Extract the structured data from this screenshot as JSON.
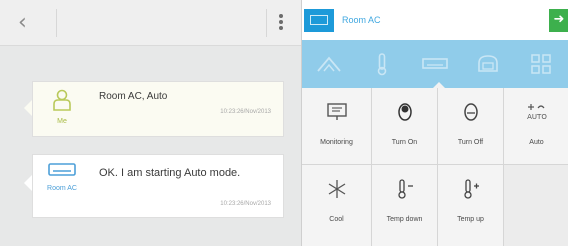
{
  "chat": {
    "messages": [
      {
        "sender": "Me",
        "text": "Room AC, Auto",
        "time": "10:23:26/Nov/2013"
      },
      {
        "sender": "Room AC",
        "text": "OK. I am starting Auto mode.",
        "time": "10:23:26/Nov/2013"
      }
    ]
  },
  "control": {
    "device_name": "Room AC",
    "tabs": [
      "cleaner",
      "thermometer",
      "aircon",
      "robot",
      "grid"
    ],
    "buttons": [
      {
        "label": "Monitoring",
        "icon": "monitor-icon"
      },
      {
        "label": "Turn On",
        "icon": "power-on-icon"
      },
      {
        "label": "Turn Off",
        "icon": "power-off-icon"
      },
      {
        "label": "Auto",
        "icon": "auto-icon"
      },
      {
        "label": "Cool",
        "icon": "snowflake-icon"
      },
      {
        "label": "Temp down",
        "icon": "temp-down-icon"
      },
      {
        "label": "Temp up",
        "icon": "temp-up-icon"
      }
    ]
  },
  "colors": {
    "accent_blue": "#1d9ad9",
    "tab_bar": "#90ccea",
    "send_green": "#3db04d",
    "user_caption": "#a9bb46"
  }
}
